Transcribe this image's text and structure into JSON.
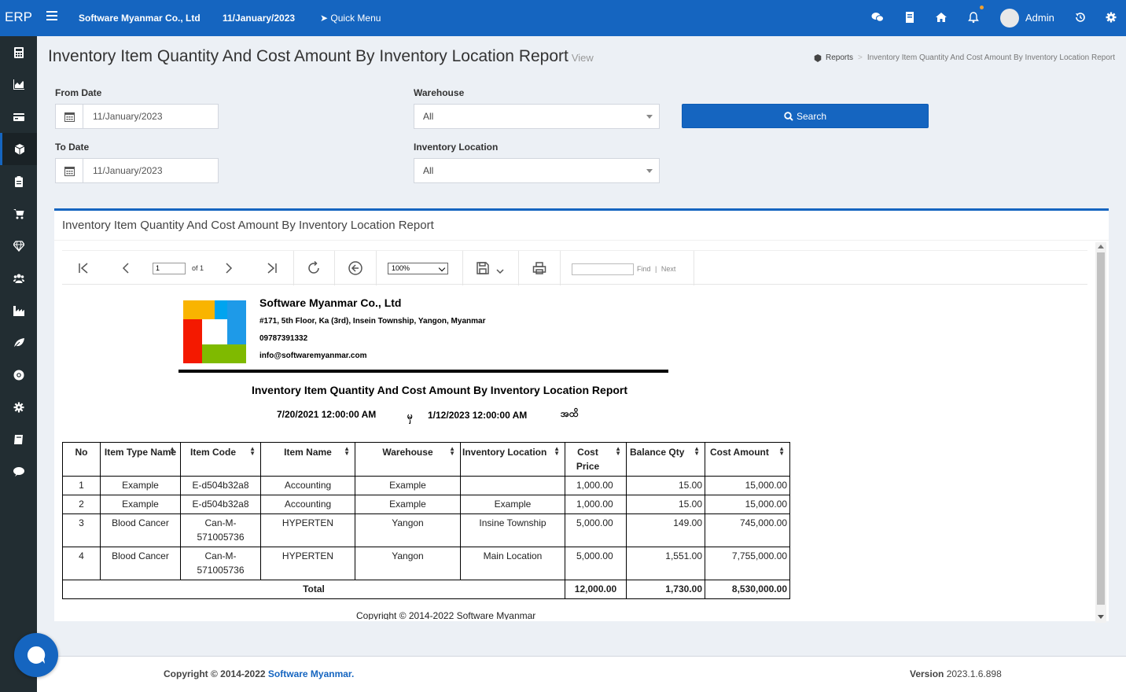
{
  "app": {
    "logo": "ERP"
  },
  "topbar": {
    "company": "Software Myanmar Co., Ltd",
    "date": "11/January/2023",
    "quick_menu": "Quick Menu",
    "user": "Admin"
  },
  "page": {
    "title": "Inventory Item Quantity And Cost Amount By Inventory Location Report",
    "subtitle": "View",
    "breadcrumb": {
      "root": "Reports",
      "current": "Inventory Item Quantity And Cost Amount By Inventory Location Report"
    }
  },
  "filters": {
    "from_date_label": "From Date",
    "from_date": "11/January/2023",
    "to_date_label": "To Date",
    "to_date": "11/January/2023",
    "warehouse_label": "Warehouse",
    "warehouse": "All",
    "location_label": "Inventory Location",
    "location": "All",
    "search_label": "Search"
  },
  "box": {
    "title": "Inventory Item Quantity And Cost Amount By Inventory Location Report"
  },
  "viewer": {
    "page": "1",
    "of": "of 1",
    "zoom": "100%",
    "find": "Find",
    "next": "Next",
    "find_sep": "|"
  },
  "report": {
    "company": "Software Myanmar Co., Ltd",
    "address": "#171, 5th Floor, Ka (3rd), Insein Township, Yangon, Myanmar",
    "phone": "09787391332",
    "email": "info@softwaremyanmar.com",
    "title": "Inventory Item Quantity And Cost Amount By Inventory Location Report",
    "from": "7/20/2021 12:00:00 AM",
    "mid": "မှ",
    "to": "1/12/2023 12:00:00 AM",
    "end": "အထိ",
    "columns": [
      "No",
      "Item Type Name",
      "Item Code",
      "Item Name",
      "Warehouse",
      "Inventory Location",
      "Cost Price",
      "Balance Qty",
      "Cost Amount"
    ],
    "rows": [
      {
        "no": "1",
        "type": "Example",
        "code": "E-d504b32a8",
        "name": "Accounting",
        "warehouse": "Example",
        "location": "",
        "cost": "1,000.00",
        "qty": "15.00",
        "amount": "15,000.00"
      },
      {
        "no": "2",
        "type": "Example",
        "code": "E-d504b32a8",
        "name": "Accounting",
        "warehouse": "Example",
        "location": "Example",
        "cost": "1,000.00",
        "qty": "15.00",
        "amount": "15,000.00"
      },
      {
        "no": "3",
        "type": "Blood Cancer",
        "code": "Can-M-571005736",
        "name": "HYPERTEN",
        "warehouse": "Yangon",
        "location": "Insine Township",
        "cost": "5,000.00",
        "qty": "149.00",
        "amount": "745,000.00"
      },
      {
        "no": "4",
        "type": "Blood Cancer",
        "code": "Can-M-571005736",
        "name": "HYPERTEN",
        "warehouse": "Yangon",
        "location": "Main Location",
        "cost": "5,000.00",
        "qty": "1,551.00",
        "amount": "7,755,000.00"
      }
    ],
    "total_label": "Total",
    "total_cost": "12,000.00",
    "total_qty": "1,730.00",
    "total_amount": "8,530,000.00",
    "copyright": "Copyright © 2014-2022 Software Myanmar"
  },
  "footer": {
    "copyright": "Copyright © 2014-2022",
    "brand": "Software Myanmar.",
    "version_label": "Version",
    "version": "2023.1.6.898"
  },
  "colors": {
    "primary": "#1565c0",
    "sidebar": "#222d32",
    "background": "#ecf0f5"
  },
  "icons": {
    "topbar": [
      "menu-icon",
      "rocket-icon",
      "wechat-icon",
      "book-icon",
      "home-icon",
      "bell-icon",
      "history-icon",
      "gear-icon"
    ],
    "sidebar": [
      "calculator-icon",
      "chart-icon",
      "credit-card-icon",
      "cube-icon",
      "clipboard-icon",
      "cart-icon",
      "diamond-icon",
      "users-icon",
      "industry-icon",
      "leaf-icon",
      "support-icon",
      "settings-icon",
      "book-icon",
      "comment-icon"
    ]
  }
}
